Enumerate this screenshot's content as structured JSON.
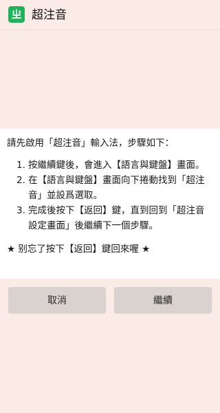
{
  "app": {
    "title": "超注音",
    "icon_glyph": "ㄓ",
    "icon_color": "#21b35b"
  },
  "instructions": {
    "intro": "請先啟用「超注音」輸入法，步驟如下：",
    "steps": [
      {
        "num": "1.",
        "text": "按繼續鍵後，會進入【語言與鍵盤】畫面。"
      },
      {
        "num": "2.",
        "text": "在【語言與鍵盤】畫面向下捲動找到「超注音」並設爲選取。"
      },
      {
        "num": "3.",
        "text": "完成後按下【返回】鍵，直到回到「超注音設定畫面」後繼續下一個步驟。"
      }
    ],
    "reminder": "★ 别忘了按下【返回】鍵回來喔 ★"
  },
  "buttons": {
    "cancel_label": "取消",
    "continue_label": "繼續"
  },
  "colors": {
    "background": "#fbebe6",
    "panel": "#ffffff",
    "button": "#d9d2cf"
  }
}
